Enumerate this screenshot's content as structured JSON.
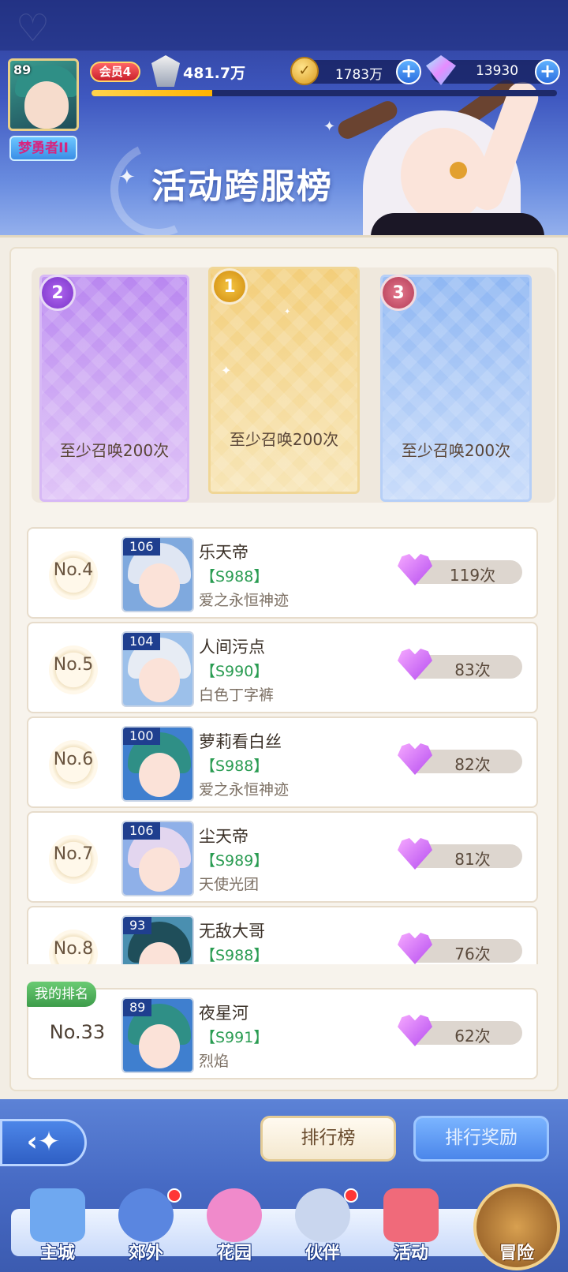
{
  "player": {
    "level": "89",
    "title": "梦勇者II",
    "vip": "会员4",
    "power": "481.7万",
    "exp_progress": 0.26
  },
  "currency": {
    "gold": "1783万",
    "gems": "13930",
    "plus": "+"
  },
  "page_title": "活动跨服榜",
  "podium": [
    {
      "place": "2",
      "label": "至少召唤200次",
      "color": "#b987f0"
    },
    {
      "place": "1",
      "label": "至少召唤200次",
      "color": "#f3ce7a"
    },
    {
      "place": "3",
      "label": "至少召唤200次",
      "color": "#8fb7f3"
    }
  ],
  "rankings": [
    {
      "rank": "No.4",
      "level": "106",
      "name": "乐天帝",
      "server": "【S988】",
      "guild": "爱之永恒神迹",
      "count": "119次",
      "hair": "#dfe6f3",
      "bg": "#7fa9de"
    },
    {
      "rank": "No.5",
      "level": "104",
      "name": "人间污点",
      "server": "【S990】",
      "guild": "白色丁字裤",
      "count": "83次",
      "hair": "#e7ecf4",
      "bg": "#9cc0ea"
    },
    {
      "rank": "No.6",
      "level": "100",
      "name": "萝莉看白丝",
      "server": "【S988】",
      "guild": "爱之永恒神迹",
      "count": "82次",
      "hair": "#2f8f86",
      "bg": "#3f7fcf"
    },
    {
      "rank": "No.7",
      "level": "106",
      "name": "尘天帝",
      "server": "【S989】",
      "guild": "天使光团",
      "count": "81次",
      "hair": "#e3d6ef",
      "bg": "#8fb0e8"
    },
    {
      "rank": "No.8",
      "level": "93",
      "name": "无敌大哥",
      "server": "【S988】",
      "guild": "",
      "count": "76次",
      "hair": "#1f4e5a",
      "bg": "#4a8fb0"
    }
  ],
  "my_rank": {
    "tag": "我的排名",
    "rank": "No.33",
    "level": "89",
    "name": "夜星河",
    "server": "【S991】",
    "guild": "烈焰",
    "count": "62次"
  },
  "actions": {
    "leaderboard": "排行榜",
    "rewards": "排行奖励"
  },
  "nav": [
    {
      "label": "主城",
      "icon": "castle-icon",
      "color": "#6fa8f0",
      "dot": false
    },
    {
      "label": "郊外",
      "icon": "compass-icon",
      "color": "#5a86e0",
      "dot": true
    },
    {
      "label": "花园",
      "icon": "heart-garden-icon",
      "color": "#f08acb",
      "dot": false
    },
    {
      "label": "伙伴",
      "icon": "partner-icon",
      "color": "#c9d6ee",
      "dot": true
    },
    {
      "label": "活动",
      "icon": "gift-icon",
      "color": "#f06a7a",
      "dot": false
    }
  ],
  "adventure": "冒险"
}
